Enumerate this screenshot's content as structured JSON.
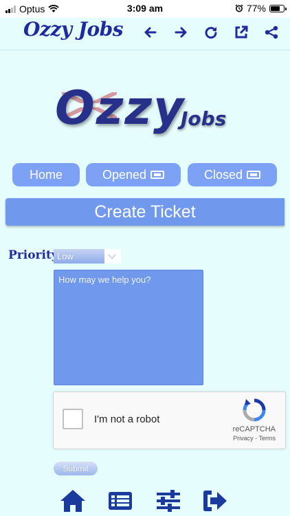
{
  "status_bar": {
    "carrier": "Optus",
    "time": "3:09 am",
    "battery_percent": "77%",
    "battery_level": 0.77,
    "icons": [
      "signal-icon",
      "wifi-icon",
      "alarm-icon",
      "battery-icon"
    ]
  },
  "app_bar": {
    "title": "Ozzy Jobs",
    "actions": [
      "back-arrow-icon",
      "forward-arrow-icon",
      "reload-icon",
      "open-external-icon",
      "share-icon"
    ]
  },
  "logo": {
    "big_text": "Ozzy",
    "small_text": "Jobs"
  },
  "nav_tabs": [
    {
      "label": "Home",
      "icon": null
    },
    {
      "label": "Opened",
      "icon": "ticket-icon"
    },
    {
      "label": "Closed",
      "icon": "ticket-icon"
    }
  ],
  "section": {
    "title": "Create Ticket"
  },
  "form": {
    "priority_label": "Priority",
    "priority_value": "Low",
    "message_placeholder": "How may we help you?",
    "submit_label": "Submit"
  },
  "captcha": {
    "label": "I'm not a robot",
    "brand": "reCAPTCHA",
    "privacy": "Privacy",
    "separator": "-",
    "terms": "Terms"
  },
  "bottom_nav": {
    "icons": [
      "home-icon",
      "list-icon",
      "filter-icon",
      "logout-icon"
    ]
  },
  "colors": {
    "background": "#e6fdfd",
    "accent": "#7da2f5",
    "brand_text": "#1f2a9e"
  }
}
